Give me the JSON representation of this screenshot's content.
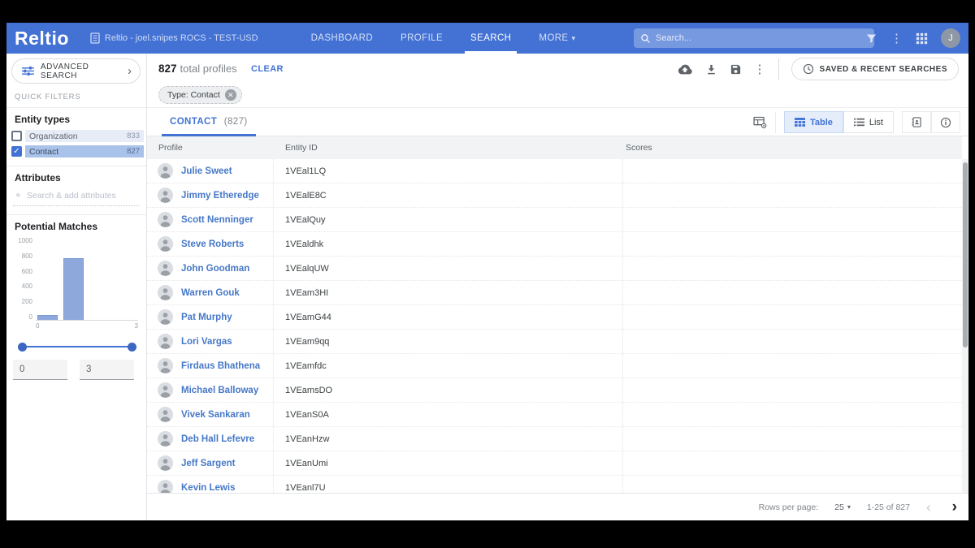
{
  "icons": {
    "kebab": "⋮",
    "chevron_right": "›",
    "chevron_left": "‹",
    "caret_down": "▾",
    "close": "✕",
    "check": "✓"
  },
  "colors": {
    "nav_blue": "#4372d4",
    "accent_blue": "#4273d4",
    "link_blue": "#4678c8",
    "bar_fill": "#8fa8dc",
    "checked_row_bg": "#a9c2ea"
  },
  "topnav": {
    "logo": "Reltio",
    "tenant": "Reltio - joel.snipes ROCS - TEST-USD",
    "items": [
      {
        "label": "DASHBOARD"
      },
      {
        "label": "PROFILE"
      },
      {
        "label": "SEARCH"
      },
      {
        "label": "MORE"
      }
    ],
    "search_placeholder": "Search...",
    "avatar_initial": "J"
  },
  "sidebar": {
    "advanced_search_label": "ADVANCED SEARCH",
    "quick_filters_label": "QUICK FILTERS",
    "entity_types": {
      "heading": "Entity types",
      "items": [
        {
          "label": "Organization",
          "count": "833",
          "checked": false
        },
        {
          "label": "Contact",
          "count": "827",
          "checked": true
        }
      ]
    },
    "attributes": {
      "heading": "Attributes",
      "search_placeholder": "Search & add attributes"
    },
    "potential_matches": {
      "heading": "Potential Matches",
      "range_min": "0",
      "range_max": "3"
    }
  },
  "chart_data": {
    "type": "bar",
    "title": "Potential Matches",
    "xlabel": "",
    "ylabel": "",
    "xlim": [
      0,
      3
    ],
    "ylim": [
      0,
      1000
    ],
    "yticks": [
      1000,
      800,
      600,
      400,
      200,
      0
    ],
    "xtick_labels": [
      "0",
      "3"
    ],
    "grid": false,
    "legend_position": "none",
    "bars": [
      {
        "x_from": 0.05,
        "x_to": 0.65,
        "value": 60
      },
      {
        "x_from": 0.8,
        "x_to": 1.4,
        "value": 780
      }
    ]
  },
  "results": {
    "total": "827",
    "total_suffix": "total profiles",
    "clear_label": "CLEAR",
    "filter_chip": "Type: Contact",
    "saved_searches_label": "SAVED & RECENT SEARCHES"
  },
  "tabs": {
    "contact_label": "CONTACT",
    "contact_count": "(827)"
  },
  "view_toggle": {
    "table_label": "Table",
    "list_label": "List"
  },
  "table": {
    "columns": [
      "Profile",
      "Entity ID",
      "Scores"
    ],
    "rows": [
      {
        "name": "Julie Sweet",
        "entity_id": "1VEal1LQ"
      },
      {
        "name": "Jimmy Etheredge",
        "entity_id": "1VEalE8C"
      },
      {
        "name": "Scott Nenninger",
        "entity_id": "1VEalQuy"
      },
      {
        "name": "Steve Roberts",
        "entity_id": "1VEaldhk"
      },
      {
        "name": "John Goodman",
        "entity_id": "1VEalqUW"
      },
      {
        "name": "Warren Gouk",
        "entity_id": "1VEam3HI"
      },
      {
        "name": "Pat Murphy",
        "entity_id": "1VEamG44"
      },
      {
        "name": "Lori Vargas",
        "entity_id": "1VEam9qq"
      },
      {
        "name": "Firdaus Bhathena",
        "entity_id": "1VEamfdc"
      },
      {
        "name": "Michael Balloway",
        "entity_id": "1VEamsDO"
      },
      {
        "name": "Vivek Sankaran",
        "entity_id": "1VEanS0A"
      },
      {
        "name": "Deb Hall Lefevre",
        "entity_id": "1VEanHzw"
      },
      {
        "name": "Jeff Sargent",
        "entity_id": "1VEanUmi"
      },
      {
        "name": "Kevin Lewis",
        "entity_id": "1VEanl7U"
      }
    ]
  },
  "pagination": {
    "rows_per_page_label": "Rows per page:",
    "rows_per_page_value": "25",
    "range_label": "1-25 of 827"
  }
}
